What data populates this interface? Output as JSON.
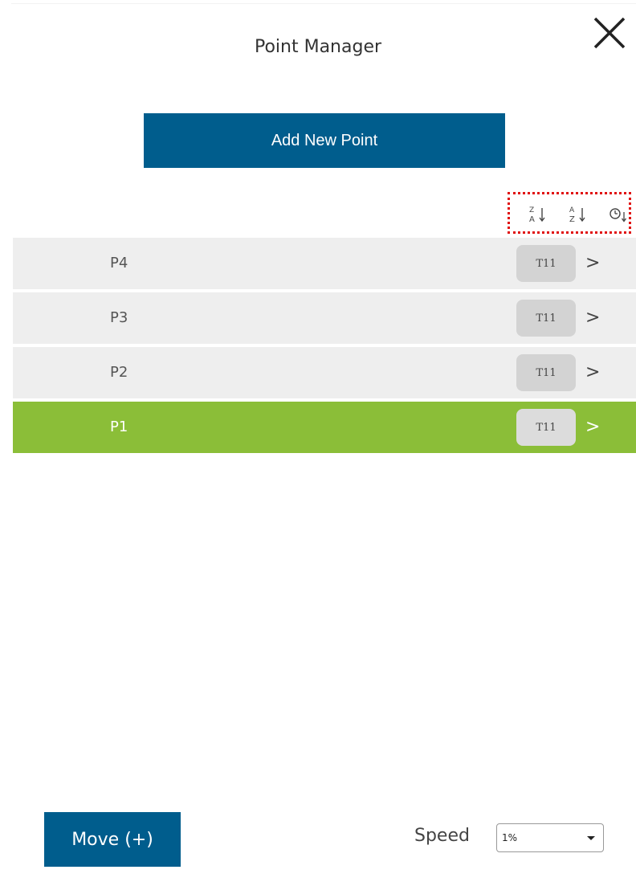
{
  "header": {
    "title": "Point Manager",
    "close_icon": "close-icon"
  },
  "toolbar": {
    "add_label": "Add New Point"
  },
  "sort": {
    "icons": [
      "sort-z-a-icon",
      "sort-a-z-icon",
      "sort-time-icon"
    ]
  },
  "points": [
    {
      "label": "P4",
      "tool": "T11",
      "selected": false
    },
    {
      "label": "P3",
      "tool": "T11",
      "selected": false
    },
    {
      "label": "P2",
      "tool": "T11",
      "selected": false
    },
    {
      "label": "P1",
      "tool": "T11",
      "selected": true
    }
  ],
  "row_chevron": ">",
  "footer": {
    "move_label": "Move (+)",
    "speed_label": "Speed",
    "speed_value": "1%"
  },
  "colors": {
    "primary": "#005d8d",
    "selected_row": "#8bbe38",
    "row_bg": "#eeeeee",
    "highlight_border": "#e01010"
  }
}
